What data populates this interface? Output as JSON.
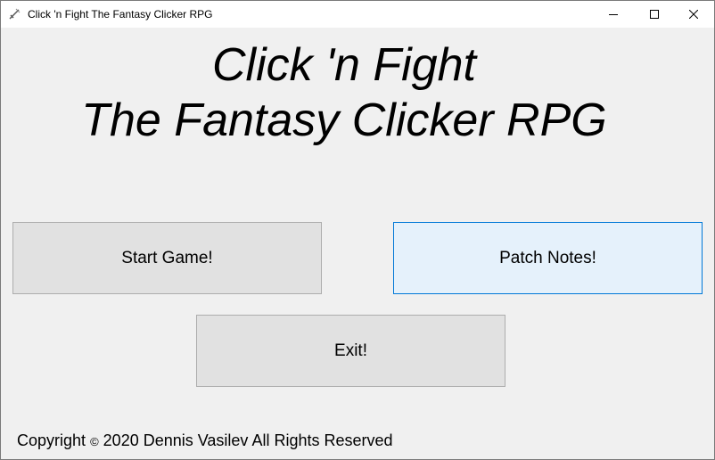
{
  "window": {
    "title": "Click 'n Fight The Fantasy Clicker RPG",
    "icon": "sword-icon"
  },
  "heading": {
    "line1": "Click 'n Fight",
    "line2": "The Fantasy Clicker RPG"
  },
  "buttons": {
    "start": "Start Game!",
    "patch_notes": "Patch Notes!",
    "exit": "Exit!"
  },
  "footer": {
    "prefix": "Copyright",
    "symbol": "©",
    "text": "2020 Dennis Vasilev All Rights Reserved"
  },
  "colors": {
    "background": "#f0f0f0",
    "button": "#e1e1e1",
    "button_hover": "#e5f1fb",
    "button_hover_border": "#0078d7"
  }
}
